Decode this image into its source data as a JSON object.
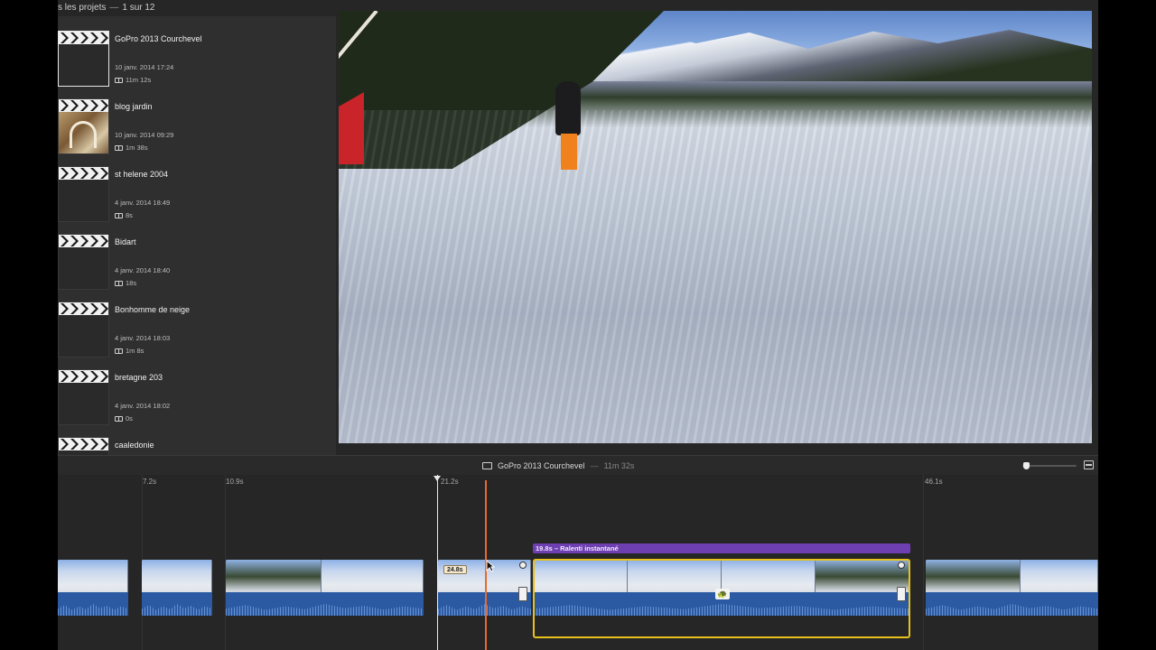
{
  "library": {
    "header_prefix": "s les projets",
    "header_sep": "—",
    "header_count": "1 sur 12",
    "projects": [
      {
        "name": "GoPro 2013 Courchevel",
        "date": "10 janv. 2014 17:24",
        "duration": "11m 12s",
        "selected": true,
        "photo": false
      },
      {
        "name": "blog jardin",
        "date": "10 janv. 2014 09:29",
        "duration": "1m 38s",
        "selected": false,
        "photo": true
      },
      {
        "name": "st helene 2004",
        "date": "4 janv. 2014 18:49",
        "duration": "8s",
        "selected": false,
        "photo": false
      },
      {
        "name": "Bidart",
        "date": "4 janv. 2014 18:40",
        "duration": "18s",
        "selected": false,
        "photo": false
      },
      {
        "name": "Bonhomme de neige",
        "date": "4 janv. 2014 18:03",
        "duration": "1m 8s",
        "selected": false,
        "photo": false
      },
      {
        "name": "bretagne 203",
        "date": "4 janv. 2014 18:02",
        "duration": "0s",
        "selected": false,
        "photo": false
      },
      {
        "name": "caaledonie",
        "date": "",
        "duration": "",
        "selected": false,
        "photo": false
      }
    ]
  },
  "timeline": {
    "project_title": "GoPro 2013 Courchevel",
    "separator": "—",
    "project_duration": "11m 32s",
    "ticks": [
      "7.2s",
      "10.9s",
      "21.2s",
      "46.1s"
    ],
    "slowmo_label": "19.8s – Ralenti instantané",
    "speed_badge": "24.8s"
  },
  "colors": {
    "selection": "#e8c11c",
    "slowmo": "#6e3fb0",
    "skimmer": "#e96a2c",
    "audio": "#2b5aa3"
  },
  "icons": {
    "project": "clapperboard-icon",
    "duration": "film-icon",
    "slowmo": "turtle-icon",
    "zoom": "filmstrip-zoom-icon"
  }
}
